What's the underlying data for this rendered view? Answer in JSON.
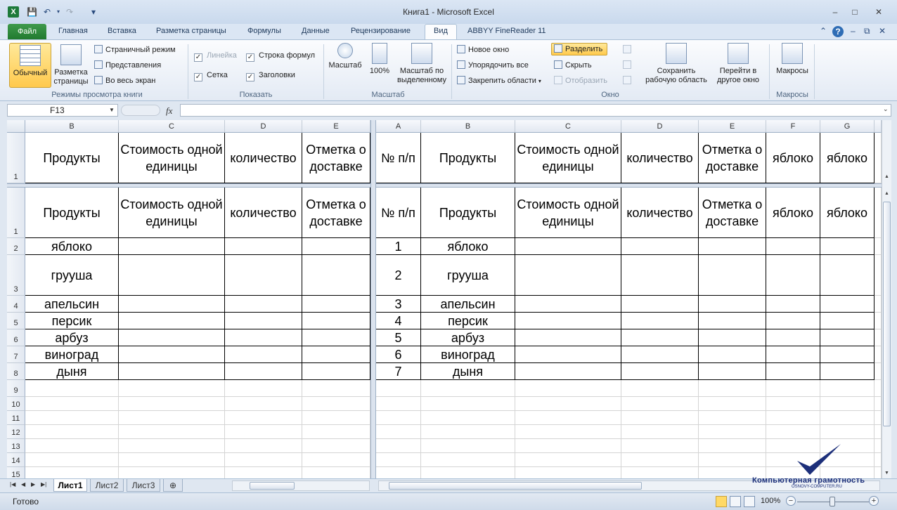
{
  "window": {
    "title": "Книга1  -  Microsoft Excel",
    "minimize": "–",
    "maximize": "□",
    "close": "✕"
  },
  "qat": {
    "app_icon": "X",
    "save": "💾",
    "undo": "↶",
    "redo": "↷",
    "customize": "▾"
  },
  "tabs": [
    "Файл",
    "Главная",
    "Вставка",
    "Разметка страницы",
    "Формулы",
    "Данные",
    "Рецензирование",
    "Вид",
    "ABBYY FineReader 11"
  ],
  "ribbon": {
    "views": {
      "normal": "Обычный",
      "page_layout": "Разметка\nстраницы",
      "page_break": "Страничный режим",
      "custom_views": "Представления",
      "full_screen": "Во весь экран",
      "group": "Режимы просмотра книги"
    },
    "show": {
      "ruler": "Линейка",
      "formula_bar": "Строка формул",
      "gridlines": "Сетка",
      "headings": "Заголовки",
      "group": "Показать"
    },
    "zoom": {
      "zoom": "Масштаб",
      "hundred": "100%",
      "selection": "Масштаб по\nвыделенному",
      "group": "Масштаб"
    },
    "window": {
      "new_window": "Новое окно",
      "arrange_all": "Упорядочить все",
      "freeze": "Закрепить области",
      "split": "Разделить",
      "hide": "Скрыть",
      "unhide": "Отобразить",
      "save_workspace": "Сохранить\nрабочую область",
      "switch_windows": "Перейти в\nдругое окно",
      "group": "Окно"
    },
    "macros": {
      "macros": "Макросы",
      "group": "Макросы"
    }
  },
  "formula_bar": {
    "name_box": "F13",
    "fx": "fx",
    "value": ""
  },
  "headers": {
    "num": "№ п/п",
    "product": "Продукты",
    "cost": "Стоимость одной единицы",
    "qty": "количество",
    "delivery": "Отметка о доставке",
    "apple": "яблоко"
  },
  "products": [
    "яблоко",
    "грууша",
    "апельсин",
    "персик",
    "арбуз",
    "виноград",
    "дыня"
  ],
  "numbers": [
    "1",
    "2",
    "3",
    "4",
    "5",
    "6",
    "7"
  ],
  "row_numbers": [
    "1",
    "2",
    "3",
    "4",
    "5",
    "6",
    "7",
    "8",
    "9",
    "10",
    "11",
    "12",
    "13",
    "14",
    "15"
  ],
  "cols_left": [
    "B",
    "C",
    "D",
    "E"
  ],
  "cols_right": [
    "A",
    "B",
    "C",
    "D",
    "E",
    "F",
    "G"
  ],
  "sheets": [
    "Лист1",
    "Лист2",
    "Лист3"
  ],
  "status": {
    "ready": "Готово",
    "zoom": "100%"
  },
  "watermark": {
    "title": "Компьютерная грамотность",
    "site": "OSNOVY-COMPUTER.RU"
  }
}
